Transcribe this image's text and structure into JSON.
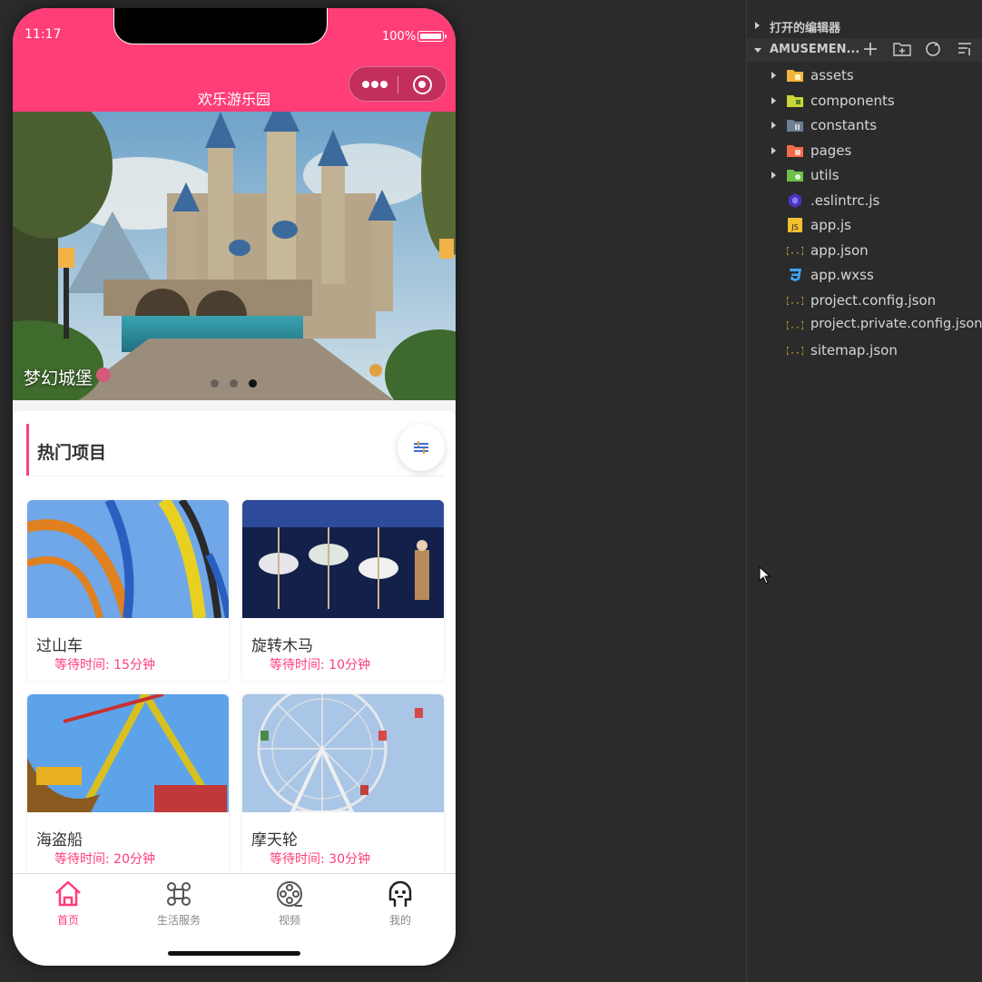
{
  "status": {
    "time": "11:17",
    "battery": "100%"
  },
  "navbar": {
    "title": "欢乐游乐园",
    "more_icon": "more-dots-icon",
    "close_icon": "target-circle-icon"
  },
  "banner": {
    "caption": "梦幻城堡",
    "slide_count": 3,
    "active_slide": 3
  },
  "hot": {
    "title": "热门项目",
    "filter_icon": "filter-icon",
    "cards": [
      {
        "name": "过山车",
        "wait": "等待时间: 15分钟"
      },
      {
        "name": "旋转木马",
        "wait": "等待时间: 10分钟"
      },
      {
        "name": "海盗船",
        "wait": "等待时间: 20分钟"
      },
      {
        "name": "摩天轮",
        "wait": "等待时间: 30分钟"
      }
    ]
  },
  "tabbar": {
    "active": "首页",
    "tabs": [
      {
        "label": "首页",
        "icon": "home-icon"
      },
      {
        "label": "生活服务",
        "icon": "command-icon"
      },
      {
        "label": "视频",
        "icon": "film-reel-icon"
      },
      {
        "label": "我的",
        "icon": "profile-face-icon"
      }
    ]
  },
  "explorer": {
    "open_editors": "打开的编辑器",
    "project": "AMUSEMEN...",
    "folders": [
      "assets",
      "components",
      "constants",
      "pages",
      "utils"
    ],
    "files": [
      ".eslintrc.js",
      "app.js",
      "app.json",
      "app.wxss",
      "project.config.json",
      "project.private.config.json",
      "sitemap.json"
    ]
  },
  "colors": {
    "brand": "#ff3d77",
    "panel_bg": "#2b2b2b"
  }
}
